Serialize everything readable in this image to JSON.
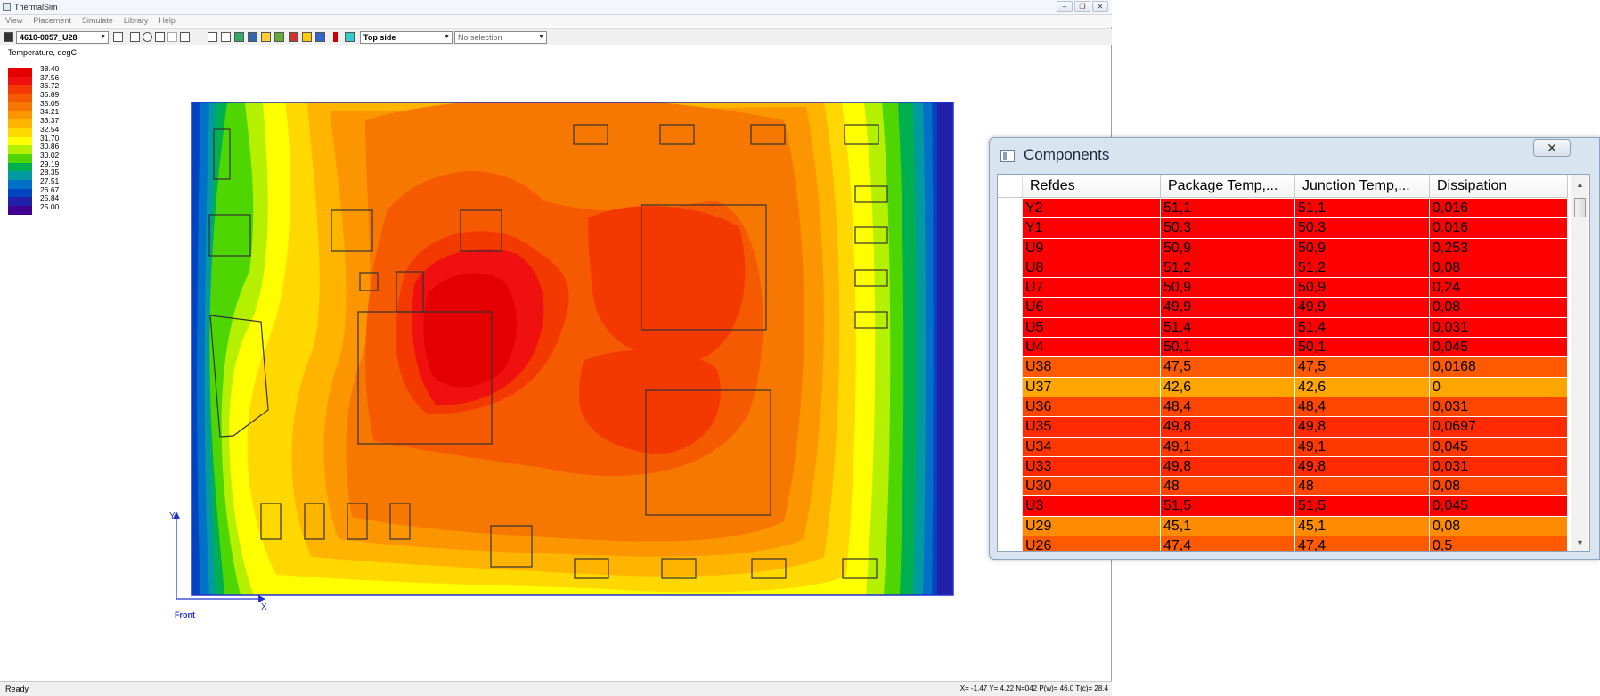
{
  "window": {
    "title": "ThermalSim",
    "min": "–",
    "max": "❐",
    "close": "✕"
  },
  "menu": [
    "View",
    "Placement",
    "Simulate",
    "Library",
    "Help"
  ],
  "toolbar": {
    "design_combo": "4610-0057_U28",
    "side_combo": "Top side",
    "selection_combo": "No selection"
  },
  "legend": {
    "title": "Temperature, degC",
    "entries": [
      {
        "label": "38.40",
        "color": "#e50000"
      },
      {
        "label": "37.56",
        "color": "#f01010"
      },
      {
        "label": "36.72",
        "color": "#f33800"
      },
      {
        "label": "35.89",
        "color": "#f55a00"
      },
      {
        "label": "35.05",
        "color": "#f77800"
      },
      {
        "label": "34.21",
        "color": "#fb9600"
      },
      {
        "label": "33.37",
        "color": "#ffb400"
      },
      {
        "label": "32.54",
        "color": "#ffd800"
      },
      {
        "label": "31.70",
        "color": "#ffff00"
      },
      {
        "label": "30.86",
        "color": "#b4f000"
      },
      {
        "label": "30.02",
        "color": "#4fd600"
      },
      {
        "label": "29.19",
        "color": "#00b050"
      },
      {
        "label": "28.35",
        "color": "#009aa0"
      },
      {
        "label": "27.51",
        "color": "#0070c8"
      },
      {
        "label": "26.67",
        "color": "#0044c0"
      },
      {
        "label": "25.84",
        "color": "#2020a8"
      },
      {
        "label": "25.00",
        "color": "#400090"
      }
    ]
  },
  "axis": {
    "y": "Y",
    "x": "X",
    "front": "Front"
  },
  "status": {
    "left": "Ready",
    "right": "X= -1.47 Y= 4.22 N=042 P(w)= 46.0 T(c)= 28.4"
  },
  "components": {
    "title": "Components",
    "close": "✕",
    "columns": [
      "Refdes",
      "Package Temp,...",
      "Junction Temp,...",
      "Dissipation"
    ],
    "rows": [
      {
        "ref": "Y2",
        "pkg": "51,1",
        "jct": "51,1",
        "dis": "0,016",
        "color": "#ff0000"
      },
      {
        "ref": "Y1",
        "pkg": "50,3",
        "jct": "50,3",
        "dis": "0,016",
        "color": "#ff0000"
      },
      {
        "ref": "U9",
        "pkg": "50,9",
        "jct": "50,9",
        "dis": "0,253",
        "color": "#ff0000"
      },
      {
        "ref": "U8",
        "pkg": "51,2",
        "jct": "51,2",
        "dis": "0,08",
        "color": "#ff0000"
      },
      {
        "ref": "U7",
        "pkg": "50,9",
        "jct": "50,9",
        "dis": "0,24",
        "color": "#ff0000"
      },
      {
        "ref": "U6",
        "pkg": "49,9",
        "jct": "49,9",
        "dis": "0,08",
        "color": "#ff0000"
      },
      {
        "ref": "U5",
        "pkg": "51,4",
        "jct": "51,4",
        "dis": "0,031",
        "color": "#ff0000"
      },
      {
        "ref": "U4",
        "pkg": "50,1",
        "jct": "50,1",
        "dis": "0,045",
        "color": "#ff0000"
      },
      {
        "ref": "U38",
        "pkg": "47,5",
        "jct": "47,5",
        "dis": "0,0168",
        "color": "#ff5a00"
      },
      {
        "ref": "U37",
        "pkg": "42,6",
        "jct": "42,6",
        "dis": "0",
        "color": "#ffa500"
      },
      {
        "ref": "U36",
        "pkg": "48,4",
        "jct": "48,4",
        "dis": "0,031",
        "color": "#ff4600"
      },
      {
        "ref": "U35",
        "pkg": "49,8",
        "jct": "49,8",
        "dis": "0,0697",
        "color": "#ff2a00"
      },
      {
        "ref": "U34",
        "pkg": "49,1",
        "jct": "49,1",
        "dis": "0,045",
        "color": "#ff3800"
      },
      {
        "ref": "U33",
        "pkg": "49,8",
        "jct": "49,8",
        "dis": "0,031",
        "color": "#ff2a00"
      },
      {
        "ref": "U30",
        "pkg": "48",
        "jct": "48",
        "dis": "0,08",
        "color": "#ff4600"
      },
      {
        "ref": "U3",
        "pkg": "51,5",
        "jct": "51,5",
        "dis": "0,045",
        "color": "#ff0000"
      },
      {
        "ref": "U29",
        "pkg": "45,1",
        "jct": "45,1",
        "dis": "0,08",
        "color": "#ff8c00"
      },
      {
        "ref": "U26",
        "pkg": "47,4",
        "jct": "47,4",
        "dis": "0,5",
        "color": "#ff5a00"
      }
    ]
  }
}
